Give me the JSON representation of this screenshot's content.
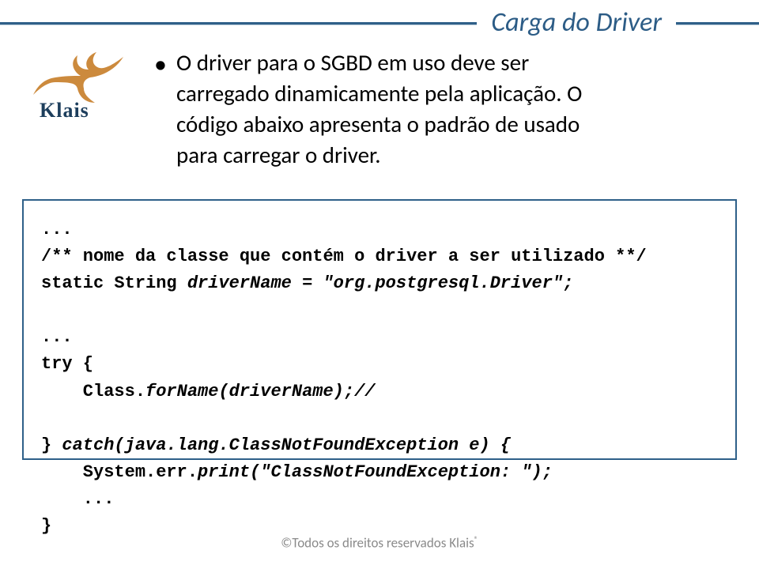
{
  "title": "Carga do Driver",
  "logo_text": "Klais",
  "bullet": {
    "line1": "O driver para o SGBD em uso deve ser",
    "line2": "carregado dinamicamente pela aplicação. O",
    "line3": "código abaixo apresenta o padrão de usado",
    "line4": "para carregar o driver."
  },
  "code": {
    "l1": "...",
    "l2a": "/** nome da classe que contém o driver a ser utilizado **/",
    "l3a": "static String ",
    "l3b": "driverName = \"org.postgresql.Driver\";",
    "l5": "...",
    "l6": "try {",
    "l7a": "    Class.",
    "l7b": "forName(driverName);//",
    "l9a": "} ",
    "l9b": "catch(java.lang.ClassNotFoundException e) {",
    "l10a": "    System.err.",
    "l10b": "print(\"ClassNotFoundException: \");",
    "l11": "    ...",
    "l12": "}"
  },
  "footer": {
    "text": "©Todos os direitos reservados Klais",
    "sup": "®"
  }
}
